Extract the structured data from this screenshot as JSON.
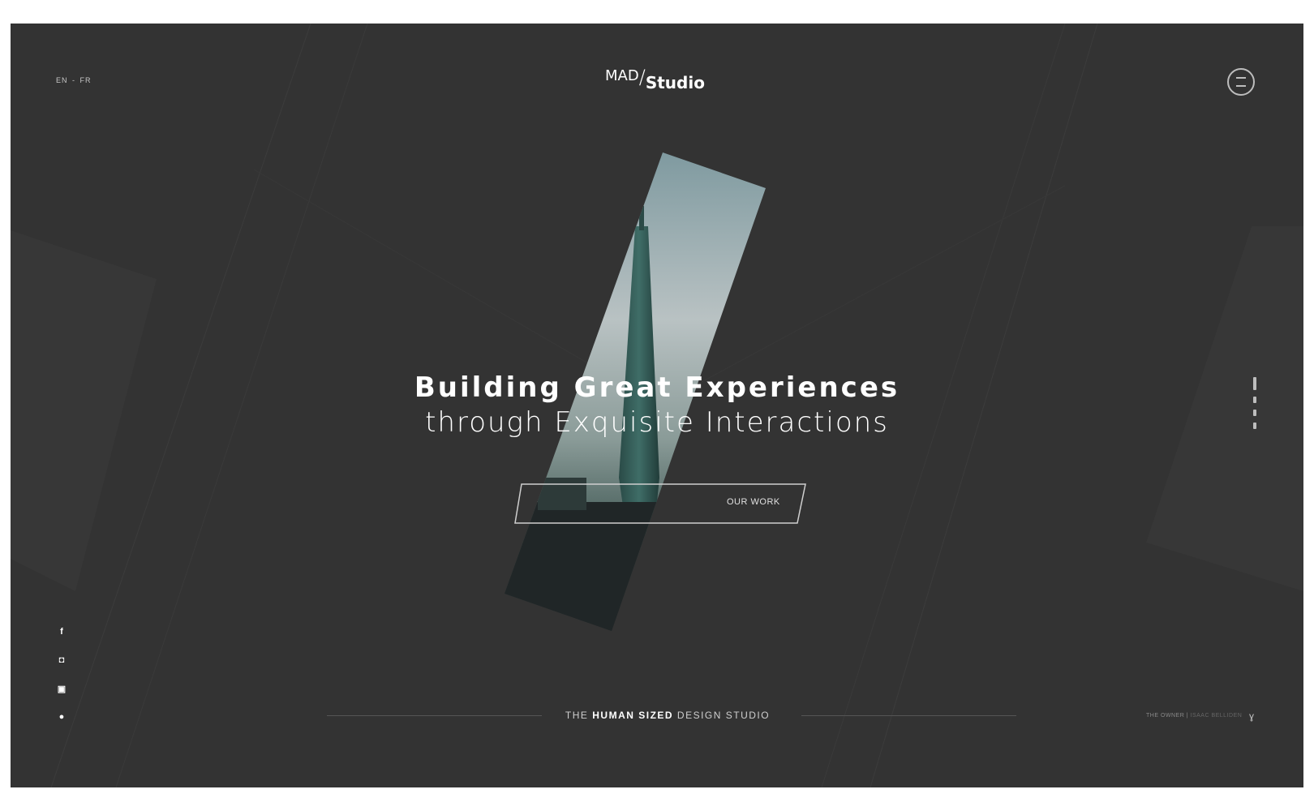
{
  "header": {
    "languages": [
      "EN",
      "FR"
    ],
    "lang_separator": "-",
    "logo": {
      "left": "MAD",
      "slash": "/",
      "right": "Studio"
    },
    "menu_icon": "menu-circle-icon"
  },
  "hero": {
    "line1": "Building Great Experiences",
    "line2": "through Exquisite Interactions",
    "cta_label": "OUR WORK",
    "image_subject": "skyscraper-photo"
  },
  "pager": {
    "count": 4,
    "active_index": 0
  },
  "social": [
    {
      "icon": "facebook-icon",
      "glyph": "f"
    },
    {
      "icon": "instagram-icon",
      "glyph": "◘"
    },
    {
      "icon": "linkedin-icon",
      "glyph": "▣"
    },
    {
      "icon": "dribbble-icon",
      "glyph": "●"
    }
  ],
  "footer": {
    "tagline_pre": "THE ",
    "tagline_bold": "HUMAN SIZED",
    "tagline_post": " DESIGN STUDIO",
    "credit_label": "THE OWNER",
    "credit_name": "ISAAC BELLIDEN",
    "credit_icon": "fy-icon"
  },
  "colors": {
    "background": "#333333",
    "text": "#ffffff",
    "muted": "#bdbdbd"
  }
}
